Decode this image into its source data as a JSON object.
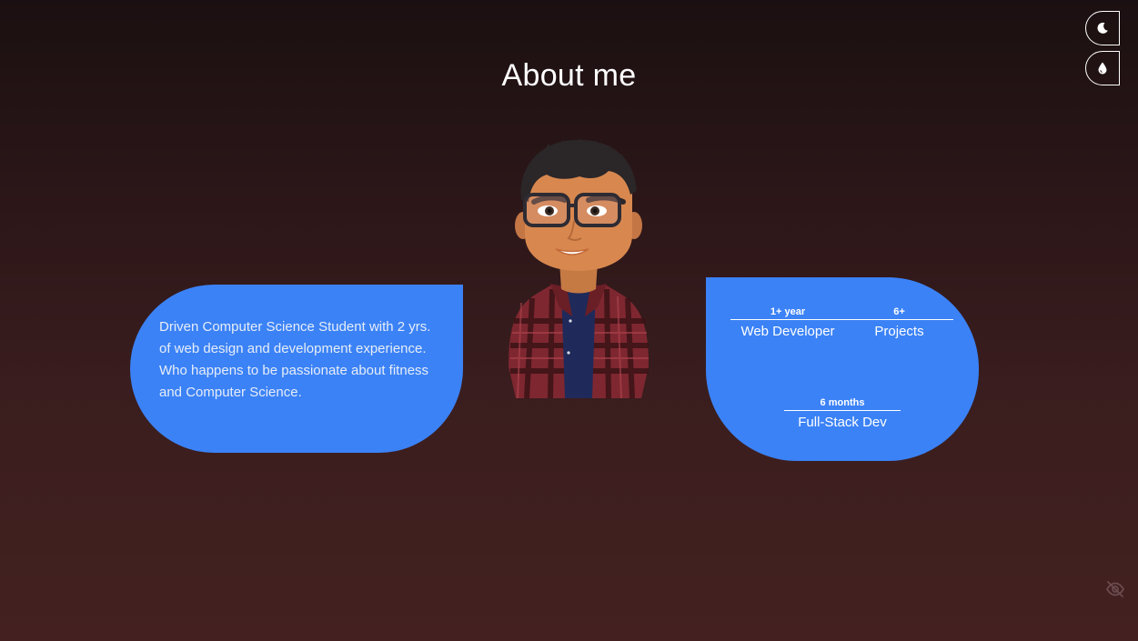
{
  "theme_buttons": {
    "dark_icon": "moon-icon",
    "color_icon": "droplet-icon"
  },
  "about": {
    "title": "About me",
    "bio": "Driven Computer Science Student with 2 yrs. of web design and development experience. Who happens to be passionate about fitness and Computer Science."
  },
  "stats": [
    {
      "value": "1+ year",
      "label": "Web Developer"
    },
    {
      "value": "6+",
      "label": "Projects"
    },
    {
      "value": "6 months",
      "label": "Full-Stack Dev"
    }
  ],
  "visibility_toggle": {
    "icon": "eye-off-icon"
  },
  "colors": {
    "card_blue": "#3b82f6",
    "background_top": "#1b1011",
    "background_bottom": "#442120"
  }
}
